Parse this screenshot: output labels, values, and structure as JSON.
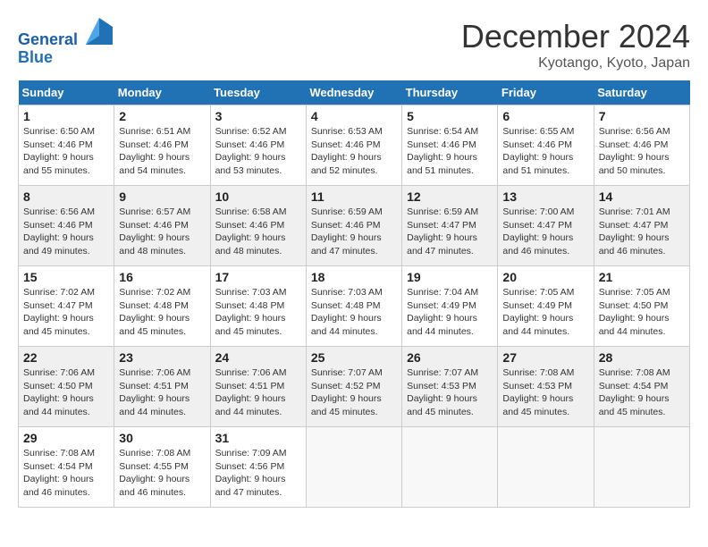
{
  "header": {
    "logo_line1": "General",
    "logo_line2": "Blue",
    "month": "December 2024",
    "location": "Kyotango, Kyoto, Japan"
  },
  "weekdays": [
    "Sunday",
    "Monday",
    "Tuesday",
    "Wednesday",
    "Thursday",
    "Friday",
    "Saturday"
  ],
  "weeks": [
    [
      {
        "day": "1",
        "sunrise": "Sunrise: 6:50 AM",
        "sunset": "Sunset: 4:46 PM",
        "daylight": "Daylight: 9 hours and 55 minutes."
      },
      {
        "day": "2",
        "sunrise": "Sunrise: 6:51 AM",
        "sunset": "Sunset: 4:46 PM",
        "daylight": "Daylight: 9 hours and 54 minutes."
      },
      {
        "day": "3",
        "sunrise": "Sunrise: 6:52 AM",
        "sunset": "Sunset: 4:46 PM",
        "daylight": "Daylight: 9 hours and 53 minutes."
      },
      {
        "day": "4",
        "sunrise": "Sunrise: 6:53 AM",
        "sunset": "Sunset: 4:46 PM",
        "daylight": "Daylight: 9 hours and 52 minutes."
      },
      {
        "day": "5",
        "sunrise": "Sunrise: 6:54 AM",
        "sunset": "Sunset: 4:46 PM",
        "daylight": "Daylight: 9 hours and 51 minutes."
      },
      {
        "day": "6",
        "sunrise": "Sunrise: 6:55 AM",
        "sunset": "Sunset: 4:46 PM",
        "daylight": "Daylight: 9 hours and 51 minutes."
      },
      {
        "day": "7",
        "sunrise": "Sunrise: 6:56 AM",
        "sunset": "Sunset: 4:46 PM",
        "daylight": "Daylight: 9 hours and 50 minutes."
      }
    ],
    [
      {
        "day": "8",
        "sunrise": "Sunrise: 6:56 AM",
        "sunset": "Sunset: 4:46 PM",
        "daylight": "Daylight: 9 hours and 49 minutes."
      },
      {
        "day": "9",
        "sunrise": "Sunrise: 6:57 AM",
        "sunset": "Sunset: 4:46 PM",
        "daylight": "Daylight: 9 hours and 48 minutes."
      },
      {
        "day": "10",
        "sunrise": "Sunrise: 6:58 AM",
        "sunset": "Sunset: 4:46 PM",
        "daylight": "Daylight: 9 hours and 48 minutes."
      },
      {
        "day": "11",
        "sunrise": "Sunrise: 6:59 AM",
        "sunset": "Sunset: 4:46 PM",
        "daylight": "Daylight: 9 hours and 47 minutes."
      },
      {
        "day": "12",
        "sunrise": "Sunrise: 6:59 AM",
        "sunset": "Sunset: 4:47 PM",
        "daylight": "Daylight: 9 hours and 47 minutes."
      },
      {
        "day": "13",
        "sunrise": "Sunrise: 7:00 AM",
        "sunset": "Sunset: 4:47 PM",
        "daylight": "Daylight: 9 hours and 46 minutes."
      },
      {
        "day": "14",
        "sunrise": "Sunrise: 7:01 AM",
        "sunset": "Sunset: 4:47 PM",
        "daylight": "Daylight: 9 hours and 46 minutes."
      }
    ],
    [
      {
        "day": "15",
        "sunrise": "Sunrise: 7:02 AM",
        "sunset": "Sunset: 4:47 PM",
        "daylight": "Daylight: 9 hours and 45 minutes."
      },
      {
        "day": "16",
        "sunrise": "Sunrise: 7:02 AM",
        "sunset": "Sunset: 4:48 PM",
        "daylight": "Daylight: 9 hours and 45 minutes."
      },
      {
        "day": "17",
        "sunrise": "Sunrise: 7:03 AM",
        "sunset": "Sunset: 4:48 PM",
        "daylight": "Daylight: 9 hours and 45 minutes."
      },
      {
        "day": "18",
        "sunrise": "Sunrise: 7:03 AM",
        "sunset": "Sunset: 4:48 PM",
        "daylight": "Daylight: 9 hours and 44 minutes."
      },
      {
        "day": "19",
        "sunrise": "Sunrise: 7:04 AM",
        "sunset": "Sunset: 4:49 PM",
        "daylight": "Daylight: 9 hours and 44 minutes."
      },
      {
        "day": "20",
        "sunrise": "Sunrise: 7:05 AM",
        "sunset": "Sunset: 4:49 PM",
        "daylight": "Daylight: 9 hours and 44 minutes."
      },
      {
        "day": "21",
        "sunrise": "Sunrise: 7:05 AM",
        "sunset": "Sunset: 4:50 PM",
        "daylight": "Daylight: 9 hours and 44 minutes."
      }
    ],
    [
      {
        "day": "22",
        "sunrise": "Sunrise: 7:06 AM",
        "sunset": "Sunset: 4:50 PM",
        "daylight": "Daylight: 9 hours and 44 minutes."
      },
      {
        "day": "23",
        "sunrise": "Sunrise: 7:06 AM",
        "sunset": "Sunset: 4:51 PM",
        "daylight": "Daylight: 9 hours and 44 minutes."
      },
      {
        "day": "24",
        "sunrise": "Sunrise: 7:06 AM",
        "sunset": "Sunset: 4:51 PM",
        "daylight": "Daylight: 9 hours and 44 minutes."
      },
      {
        "day": "25",
        "sunrise": "Sunrise: 7:07 AM",
        "sunset": "Sunset: 4:52 PM",
        "daylight": "Daylight: 9 hours and 45 minutes."
      },
      {
        "day": "26",
        "sunrise": "Sunrise: 7:07 AM",
        "sunset": "Sunset: 4:53 PM",
        "daylight": "Daylight: 9 hours and 45 minutes."
      },
      {
        "day": "27",
        "sunrise": "Sunrise: 7:08 AM",
        "sunset": "Sunset: 4:53 PM",
        "daylight": "Daylight: 9 hours and 45 minutes."
      },
      {
        "day": "28",
        "sunrise": "Sunrise: 7:08 AM",
        "sunset": "Sunset: 4:54 PM",
        "daylight": "Daylight: 9 hours and 45 minutes."
      }
    ],
    [
      {
        "day": "29",
        "sunrise": "Sunrise: 7:08 AM",
        "sunset": "Sunset: 4:54 PM",
        "daylight": "Daylight: 9 hours and 46 minutes."
      },
      {
        "day": "30",
        "sunrise": "Sunrise: 7:08 AM",
        "sunset": "Sunset: 4:55 PM",
        "daylight": "Daylight: 9 hours and 46 minutes."
      },
      {
        "day": "31",
        "sunrise": "Sunrise: 7:09 AM",
        "sunset": "Sunset: 4:56 PM",
        "daylight": "Daylight: 9 hours and 47 minutes."
      },
      {
        "day": "",
        "sunrise": "",
        "sunset": "",
        "daylight": ""
      },
      {
        "day": "",
        "sunrise": "",
        "sunset": "",
        "daylight": ""
      },
      {
        "day": "",
        "sunrise": "",
        "sunset": "",
        "daylight": ""
      },
      {
        "day": "",
        "sunrise": "",
        "sunset": "",
        "daylight": ""
      }
    ]
  ]
}
